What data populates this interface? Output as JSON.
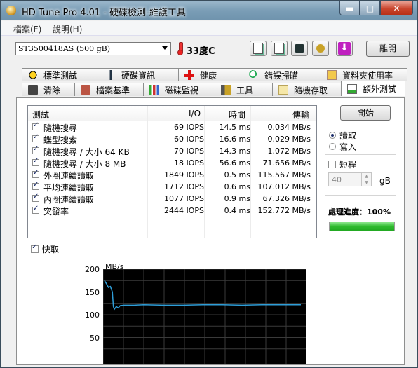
{
  "window": {
    "title": "HD Tune Pro 4.01 - 硬碟檢測-維護工具",
    "controls": {
      "minimize": "▬",
      "maximize": "□",
      "close": "✕"
    }
  },
  "menu": {
    "items": [
      "檔案(F)",
      "說明(H)"
    ]
  },
  "toolbar": {
    "drive": "ST3500418AS (500 gB)",
    "temperature": "33度C",
    "exit_label": "離開"
  },
  "tabs": {
    "row1": [
      "標準測試",
      "硬碟資訊",
      "健康",
      "錯誤掃瞄",
      "資料夾使用率"
    ],
    "row2": [
      "清除",
      "檔案基準",
      "磁碟監視",
      "工具",
      "隨機存取",
      "額外測試"
    ],
    "active": "額外測試"
  },
  "table": {
    "headers": {
      "test": "測試",
      "io": "I/O",
      "time": "時間",
      "speed": "傳輸"
    },
    "rows": [
      {
        "name": "隨機搜尋",
        "io": "69 IOPS",
        "time": "14.5 ms",
        "speed": "0.034 MB/s"
      },
      {
        "name": "蝶型搜索",
        "io": "60 IOPS",
        "time": "16.6 ms",
        "speed": "0.029 MB/s"
      },
      {
        "name": "隨機搜尋 / 大小 64 KB",
        "io": "70 IOPS",
        "time": "14.3 ms",
        "speed": "1.072 MB/s"
      },
      {
        "name": "隨機搜尋 / 大小 8 MB",
        "io": "18 IOPS",
        "time": "56.6 ms",
        "speed": "71.656 MB/s"
      },
      {
        "name": "外圈連續讀取",
        "io": "1849 IOPS",
        "time": "0.5 ms",
        "speed": "115.567 MB/s"
      },
      {
        "name": "平均連續讀取",
        "io": "1712 IOPS",
        "time": "0.6 ms",
        "speed": "107.012 MB/s"
      },
      {
        "name": "內圈連續讀取",
        "io": "1077 IOPS",
        "time": "0.9 ms",
        "speed": "67.326 MB/s"
      },
      {
        "name": "突發率",
        "io": "2444 IOPS",
        "time": "0.4 ms",
        "speed": "152.772 MB/s"
      }
    ]
  },
  "side": {
    "start_label": "開始",
    "read_label": "讀取",
    "write_label": "寫入",
    "short_label": "短程",
    "size_value": "40",
    "size_unit": "gB",
    "progress_label": "處理進度：",
    "progress_value": "100%",
    "progress_fraction": 1.0
  },
  "cache_label": "快取",
  "chart_data": {
    "type": "line",
    "ylabel": "MB/s",
    "y_ticks": [
      200,
      150,
      100,
      50
    ],
    "ylim": [
      0,
      200
    ],
    "series": [
      {
        "color": "#2f9ed8",
        "x": [
          0,
          1,
          2,
          3,
          4,
          4.5,
          5,
          6,
          7,
          8,
          10,
          15,
          20,
          30,
          40,
          50,
          60,
          70,
          80,
          90,
          100
        ],
        "values": [
          175,
          168,
          160,
          162,
          150,
          118,
          112,
          118,
          115,
          120,
          121,
          121,
          122,
          121,
          121,
          122,
          122,
          121,
          122,
          122,
          122
        ]
      }
    ]
  }
}
